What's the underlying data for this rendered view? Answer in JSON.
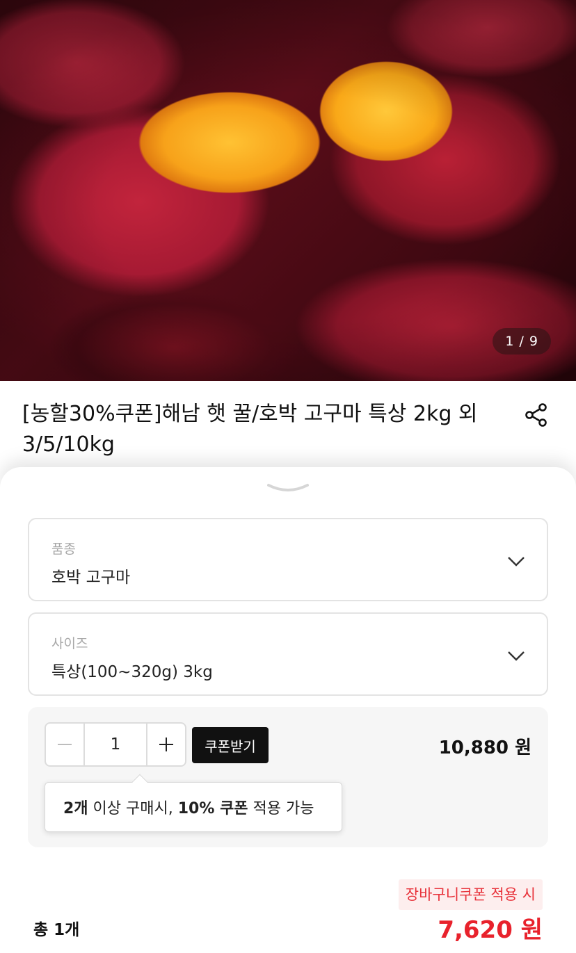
{
  "hero": {
    "image_alt": "roasted sweet potatoes",
    "page_indicator": "1 / 9"
  },
  "product": {
    "title": "[농할30%쿠폰]해남 햇 꿀/호박 고구마 특상 2kg 외 3/5/10kg"
  },
  "options": [
    {
      "label": "품종",
      "value": "호박 고구마"
    },
    {
      "label": "사이즈",
      "value": "특상(100~320g) 3kg"
    }
  ],
  "quantity": {
    "value": "1",
    "coupon_button": "쿠폰받기",
    "price": "10,880 원",
    "tooltip": {
      "count": "2개",
      "text1": " 이상 구매시, ",
      "discount": "10% 쿠폰",
      "text2": " 적용 가능"
    }
  },
  "summary": {
    "cart_coupon_label": "장바구니쿠폰 적용 시",
    "total_count": "총 1개",
    "total_price": "7,620 원"
  },
  "colors": {
    "accent_red": "#e8222c",
    "coupon_button_bg": "#111111",
    "cart_coupon_bg": "#fdeeee"
  },
  "icons": [
    "share-icon",
    "sheet-handle-icon",
    "chevron-down-icon",
    "minus-icon",
    "plus-icon"
  ]
}
